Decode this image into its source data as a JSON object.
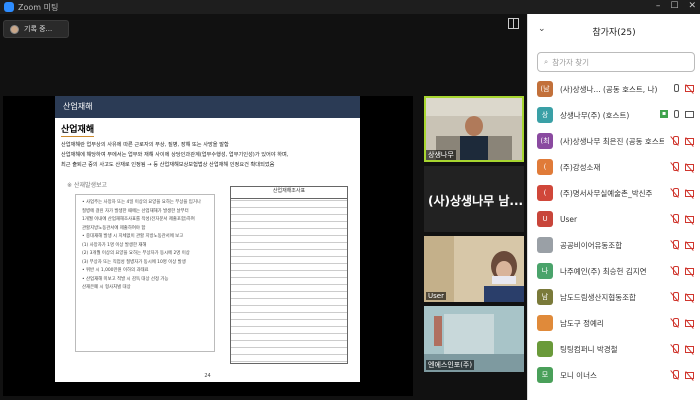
{
  "titlebar": {
    "title": "Zoom 미팅"
  },
  "recording": {
    "label": "기록 중..."
  },
  "slide": {
    "header": "산업재해",
    "subtitle": "산업재해",
    "line1": "산업재해란 업무상의 사유에 따른 근로자의 부상, 질병, 장해 또는 사망을 말함",
    "line2": "산업재해에 해당하여 부에서는 업무와 재해 사이에 상당인과관계(업무수행성, 업무기인성)가 있어야 하며,",
    "line3": "최근 출퇴근 중의 사고도 산재로 인정됨 → 등 산업재해보상보험법상 산업재해 인정요건 확대되었음",
    "section": "※ 산재발생보고",
    "box_lines": [
      "• 사업주는 사망자 또는 4일 이상의 요양을 요하는 부상을 입거나",
      "  질병에 걸린 자가 발생한 때에는 산업재해가 발생한 날부터",
      "  1개월 이내에 산업재해조사표를 작성(전자문서 제출포함)하여",
      "  관할지방노동관서에 제출하여야 함",
      "• 중대재해 발생 시 지체없이 관할 지방노동관서에 보고",
      "  (1) 사망자가 1명 이상 발생한 재해",
      "  (2) 3개월 이상의 요양을 요하는 부상자가 동시에 2명 이상",
      "  (3) 부상자 또는 직업성 질병자가 동시에 10명 이상 발생",
      "• 위반 시 1,000만원 이하의 과태료",
      "• 산업재해 미보고 적발 시 감독 대상 선정 가능",
      "  산재은폐 시 형사처벌 대상"
    ],
    "form_title": "산업재해조사표",
    "page": "24"
  },
  "tiles": [
    {
      "label": "상생나무",
      "big": ""
    },
    {
      "label": "",
      "big": "(사)상생나무 남..."
    },
    {
      "label": "User",
      "big": ""
    },
    {
      "label": "엔에스인포(주)",
      "big": ""
    }
  ],
  "panel": {
    "title": "참가자(25)",
    "search_placeholder": "참가자 찾기",
    "participants": [
      {
        "initial": "(남",
        "name": "(사)상생나... (공동 호스트, 나)",
        "color": "#c2703a",
        "icons": [
          "mic-on",
          "cam-off"
        ]
      },
      {
        "initial": "상",
        "name": "상생나무(주) (호스트)",
        "color": "#3aa0a6",
        "icons": [
          "cc",
          "mic-on",
          "cam-on"
        ]
      },
      {
        "initial": "(최",
        "name": "(사)상생나무 최은진 (공동 호스트)",
        "color": "#8a4aa0",
        "icons": [
          "mic-off",
          "cam-off"
        ]
      },
      {
        "initial": "(",
        "name": "(주)강성소재",
        "color": "#e07b39",
        "icons": [
          "mic-off",
          "cam-off"
        ]
      },
      {
        "initial": "(",
        "name": "(주)명서사무실예술촌_박신주",
        "color": "#d0473a",
        "icons": [
          "mic-off",
          "cam-off"
        ]
      },
      {
        "initial": "U",
        "name": "User",
        "color": "#c8453a",
        "icons": [
          "mic-off",
          "cam-off"
        ]
      },
      {
        "initial": "",
        "name": "공공비이어유동조합",
        "color": "#9aa0a6",
        "icons": [
          "mic-off",
          "cam-off"
        ]
      },
      {
        "initial": "나",
        "name": "나주예인(주) 최승헌 김지연",
        "color": "#4aa36b",
        "icons": [
          "mic-off",
          "cam-off"
        ]
      },
      {
        "initial": "남",
        "name": "남도드림생산지협동조합",
        "color": "#7a7a3a",
        "icons": [
          "mic-off",
          "cam-off"
        ]
      },
      {
        "initial": "",
        "name": "남도구 정예리",
        "color": "#e08a3a",
        "icons": [
          "mic-off",
          "cam-off"
        ]
      },
      {
        "initial": "",
        "name": "팅팅컴퍼니 박경철",
        "color": "#6a9a3a",
        "icons": [
          "mic-off",
          "cam-off"
        ]
      },
      {
        "initial": "모",
        "name": "모니 이너스",
        "color": "#4aa05a",
        "icons": [
          "mic-off",
          "cam-off"
        ]
      }
    ]
  },
  "colors": {
    "active_speaker": "#a8d630",
    "mute_red": "#d0362e",
    "slide_header": "#2b3b55"
  }
}
